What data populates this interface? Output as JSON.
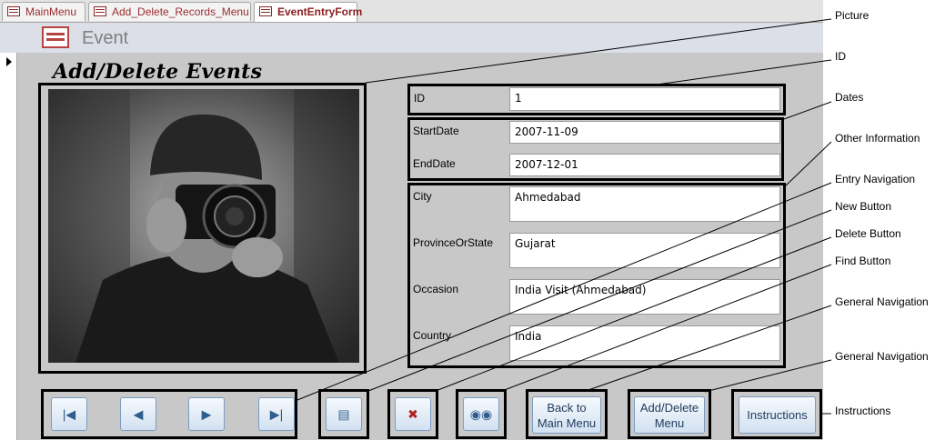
{
  "tabs": [
    {
      "label": "MainMenu"
    },
    {
      "label": "Add_Delete_Records_Menu"
    },
    {
      "label": "EventEntryForm"
    }
  ],
  "form": {
    "header_title": "Event",
    "title": "Add/Delete Events",
    "fields": {
      "id": {
        "label": "ID",
        "value": "1"
      },
      "start_date": {
        "label": "StartDate",
        "value": "2007-11-09"
      },
      "end_date": {
        "label": "EndDate",
        "value": "2007-12-01"
      },
      "city": {
        "label": "City",
        "value": "Ahmedabad"
      },
      "province": {
        "label": "ProvinceOrState",
        "value": "Gujarat"
      },
      "occasion": {
        "label": "Occasion",
        "value": "India Visit (Ahmedabad)"
      },
      "country": {
        "label": "Country",
        "value": "India"
      }
    },
    "photo": {
      "icon": "photographer-image"
    }
  },
  "buttons": {
    "first_icon": "first-record-icon",
    "prev_icon": "previous-record-icon",
    "next_icon": "next-record-icon",
    "last_icon": "last-record-icon",
    "new_icon": "new-record-icon",
    "delete_icon": "delete-record-icon",
    "find_icon": "binoculars-icon",
    "back_label_1": "Back to",
    "back_label_2": "Main Menu",
    "adddel_label_1": "Add/Delete",
    "adddel_label_2": "Menu",
    "instructions_label": "Instructions"
  },
  "callouts": [
    "Picture",
    "ID",
    "Dates",
    "Other Information",
    "Entry Navigation",
    "New Button",
    "Delete Button",
    "Find Button",
    "General Navigation",
    "General Navigation",
    "Instructions"
  ]
}
